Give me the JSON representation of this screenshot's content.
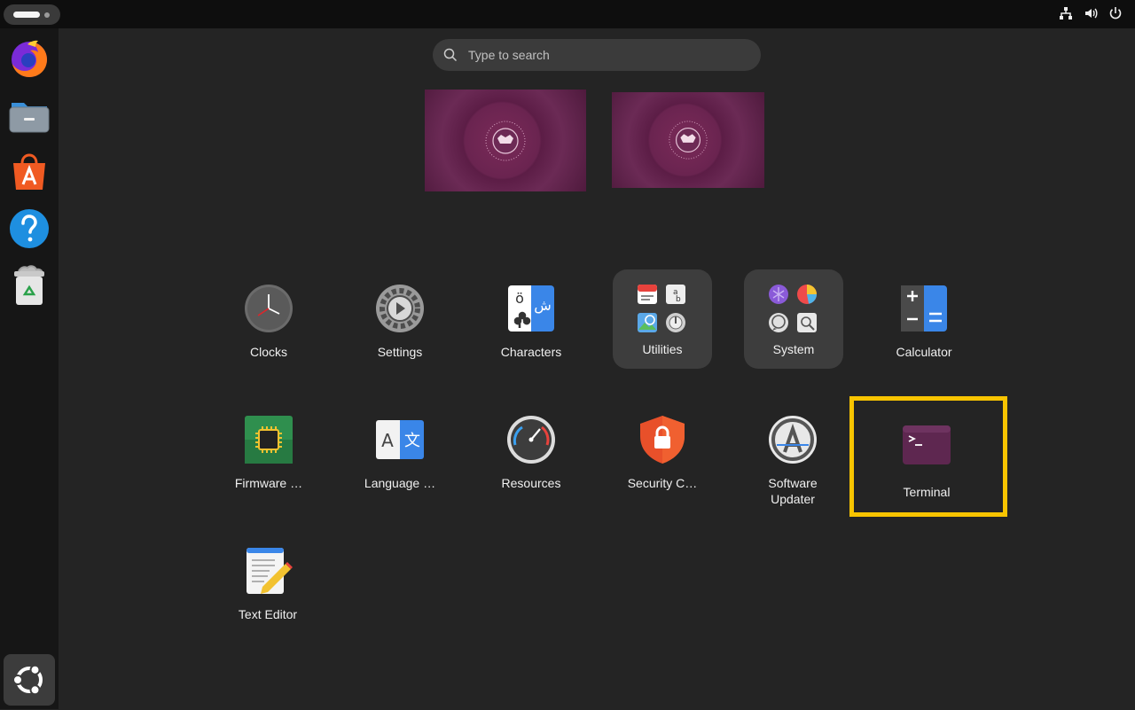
{
  "search": {
    "placeholder": "Type to search"
  },
  "dock": {
    "items": [
      {
        "name": "Firefox"
      },
      {
        "name": "Files"
      },
      {
        "name": "App Center"
      },
      {
        "name": "Help"
      },
      {
        "name": "Trash"
      }
    ]
  },
  "apps": {
    "clocks": "Clocks",
    "settings": "Settings",
    "characters": "Characters",
    "utilities": "Utilities",
    "system": "System",
    "calculator": "Calculator",
    "firmware": "Firmware …",
    "language": "Language …",
    "resources": "Resources",
    "security": "Security C…",
    "updater_line1": "Software",
    "updater_line2": "Updater",
    "terminal": "Terminal",
    "text_editor": "Text Editor"
  },
  "glyphs": {
    "characters_top": "ö",
    "characters_arabic": "ش",
    "language_a": "A",
    "language_cjk": "文"
  },
  "colors": {
    "highlight": "#f8c400",
    "ubuntu_purple": "#5c1d46",
    "terminal": "#5e2750"
  }
}
